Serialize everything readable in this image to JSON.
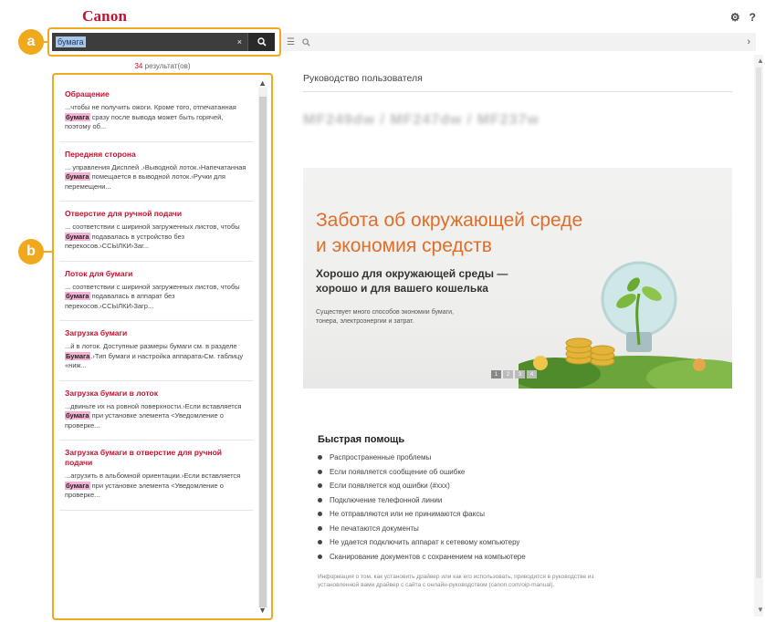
{
  "header": {
    "logo": "Canon",
    "settings_icon": "⚙",
    "help_icon": "?"
  },
  "search": {
    "value": "бумага",
    "clear": "×",
    "button_icon": "🔍",
    "result_count_num": "34",
    "result_count_text": " результат(ов)"
  },
  "callouts": {
    "a": "a",
    "b": "b"
  },
  "results": [
    {
      "title": "Обращение",
      "pre": "...чтобы не получить ожоги. Кроме того, отпечатанная ",
      "hl": "бумага",
      "post": " сразу после вывода может быть горячей, поэтому об..."
    },
    {
      "title": "Передняя сторона",
      "pre": "... управления   Дисплей .›Выводной лоток.›Напечатанная ",
      "hl": "бумага",
      "post": " помещается в выводной лоток.›Ручки для перемещени..."
    },
    {
      "title": "Отверстие для ручной подачи",
      "pre": "... соответствии с шириной загруженных листов, чтобы ",
      "hl": "бумага",
      "post": " подавалась в устройство без перекосов.›ССЫЛКИ›Заг..."
    },
    {
      "title": "Лоток для бумаги",
      "pre": "... соответствии с шириной загруженных листов, чтобы ",
      "hl": "бумага",
      "post": " подавалась в аппарат без перекосов.›ССЫЛКИ›Загр..."
    },
    {
      "title": "Загрузка бумаги",
      "pre": "...й в лоток. Доступные размеры бумаги см. в разделе ",
      "hl": "Бумага",
      "post": ".›Тип бумаги и настройка аппарата›См. таблицу «ниж..."
    },
    {
      "title": "Загрузка бумаги в лоток",
      "pre": "...двиньте их на ровной поверхности.›Если вставляется ",
      "hl": "бумага",
      "post": " при установке элемента <Уведомление о проверке..."
    },
    {
      "title": "Загрузка бумаги в отверстие для ручной подачи",
      "pre": "...агрузить в альбомной ориентации.›Если вставляется ",
      "hl": "бумага",
      "post": " при установке элемента <Уведомление о проверке..."
    }
  ],
  "toolbar": {
    "list_icon": "☰",
    "search_icon": "🔍",
    "next_icon": "›"
  },
  "content": {
    "doc_title": "Руководство пользователя",
    "model_title": "MF249dw / MF247dw / MF237w",
    "banner": {
      "h1_line1": "Забота об окружающей среде",
      "h1_line2": "и экономия средств",
      "h2_line1": "Хорошо для окружающей среды —",
      "h2_line2": "хорошо и для вашего кошелька",
      "p_line1": "Существует много способов экономии бумаги,",
      "p_line2": "тонера, электроэнергии и затрат.",
      "dots": [
        "1",
        "2",
        "3",
        "4"
      ]
    },
    "quick_title": "Быстрая помощь",
    "quick_items": [
      "Распространенные проблемы",
      "Если появляется сообщение об ошибке",
      "Если появляется код ошибки (#xxx)",
      "Подключение телефонной линии",
      "Не отправляются или не принимаются факсы",
      "Не печатаются документы",
      "Не удается подключить аппарат к сетевому компьютеру",
      "Сканирование документов с сохранением на компьютере"
    ],
    "footnote": "Информация о том, как установить драйвер или как его использовать, приводится в руководстве из установленной вами драйвер с сайта с онлайн-руководством (canon.com/oip-manual)."
  }
}
